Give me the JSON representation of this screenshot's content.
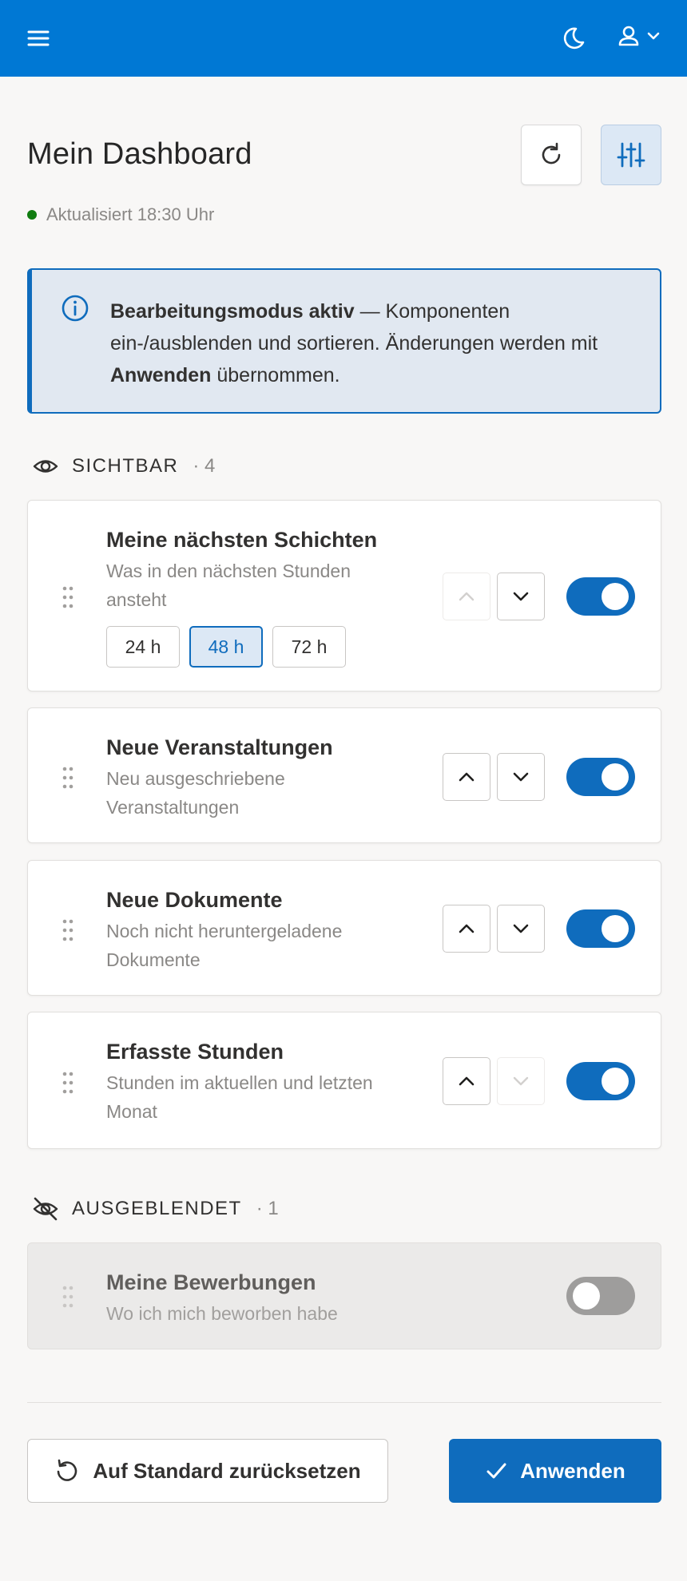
{
  "header": {
    "icons": [
      "hamburger-menu-icon",
      "moon-icon",
      "user-icon",
      "chevron-down-icon"
    ]
  },
  "page": {
    "title": "Mein Dashboard",
    "status": "Aktualisiert 18:30 Uhr",
    "status_color": "#107c10",
    "refresh_icon": "refresh-icon",
    "customize_icon": "sliders-icon"
  },
  "banner": {
    "bold": "Bearbeitungsmodus aktiv",
    "text_1": " — Komponenten ein-/ausblenden und sortieren. Änderungen werden mit ",
    "bold_2": "Anwenden",
    "text_2": " übernommen.",
    "icon": "info-icon"
  },
  "visible_section": {
    "label": "SICHTBAR",
    "count": "· 4",
    "icon": "eye-icon"
  },
  "hidden_section": {
    "label": "AUSGEBLENDET",
    "count": "· 1",
    "icon": "eye-off-icon"
  },
  "widgets": [
    {
      "title": "Meine nächsten Schichten",
      "subtitle": "Was in den nächsten Stunden ansteht",
      "visible": true,
      "can_move_up": false,
      "can_move_down": true,
      "ranges": [
        "24 h",
        "48 h",
        "72 h"
      ],
      "selected_range": "48 h"
    },
    {
      "title": "Neue Veranstaltungen",
      "subtitle": "Neu ausgeschriebene Veranstaltungen",
      "visible": true,
      "can_move_up": true,
      "can_move_down": true
    },
    {
      "title": "Neue Dokumente",
      "subtitle": "Noch nicht heruntergeladene Dokumente",
      "visible": true,
      "can_move_up": true,
      "can_move_down": true
    },
    {
      "title": "Erfasste Stunden",
      "subtitle": "Stunden im aktuellen und letzten Monat",
      "visible": true,
      "can_move_up": true,
      "can_move_down": false
    }
  ],
  "hidden_widgets": [
    {
      "title": "Meine Bewerbungen",
      "subtitle": "Wo ich mich beworben habe",
      "visible": false
    }
  ],
  "footer": {
    "reset_label": "Auf Standard zurücksetzen",
    "apply_label": "Anwenden",
    "reset_icon": "reset-icon",
    "apply_icon": "check-icon"
  },
  "colors": {
    "topbar": "#0078d4",
    "accent": "#0f6cbd",
    "banner_bg": "#e1e8f1",
    "toggle_off": "#9e9d9c"
  }
}
